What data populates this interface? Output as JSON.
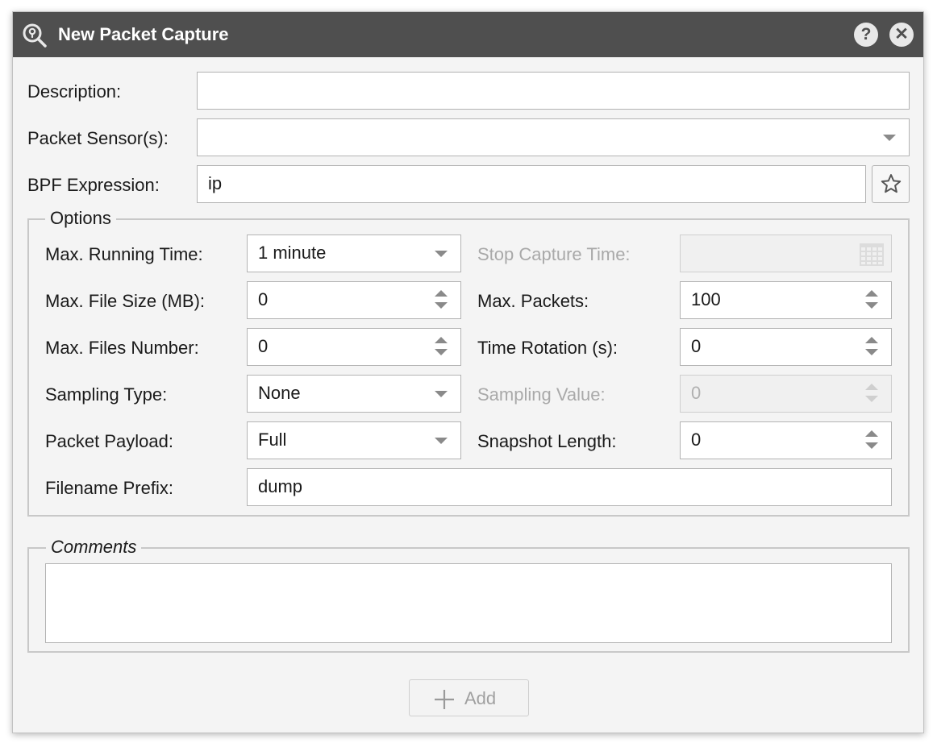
{
  "dialog": {
    "title": "New Packet Capture",
    "title_icon": "capture-search-icon",
    "help_icon_glyph": "?",
    "close_icon_glyph": "✕"
  },
  "form": {
    "description": {
      "label": "Description:",
      "value": ""
    },
    "sensors": {
      "label": "Packet Sensor(s):",
      "value": ""
    },
    "bpf": {
      "label": "BPF Expression:",
      "value": "ip",
      "favorite_icon": "star-icon"
    }
  },
  "options": {
    "legend": "Options",
    "max_running_time": {
      "label": "Max. Running Time:",
      "value": "1 minute"
    },
    "stop_capture_time": {
      "label": "Stop Capture Time:",
      "value": "",
      "icon": "calendar-icon"
    },
    "max_file_size": {
      "label": "Max. File Size (MB):",
      "value": "0"
    },
    "max_packets": {
      "label": "Max. Packets:",
      "value": "100"
    },
    "max_files_number": {
      "label": "Max. Files Number:",
      "value": "0"
    },
    "time_rotation": {
      "label": "Time Rotation (s):",
      "value": "0"
    },
    "sampling_type": {
      "label": "Sampling Type:",
      "value": "None"
    },
    "sampling_value": {
      "label": "Sampling Value:",
      "value": "0"
    },
    "packet_payload": {
      "label": "Packet Payload:",
      "value": "Full"
    },
    "snapshot_length": {
      "label": "Snapshot Length:",
      "value": "0"
    },
    "filename_prefix": {
      "label": "Filename Prefix:",
      "value": "dump"
    }
  },
  "comments": {
    "legend": "Comments",
    "value": ""
  },
  "actions": {
    "add_label": "Add",
    "add_icon": "plus-icon"
  },
  "colors": {
    "titlebar": "#4f4f4f",
    "dialog_bg": "#f4f4f4",
    "disabled_text": "#a9a9a9"
  }
}
